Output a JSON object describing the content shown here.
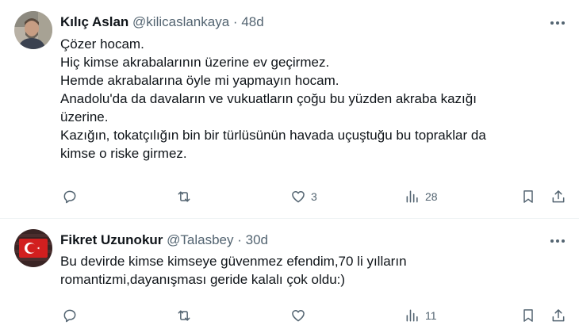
{
  "tweets": [
    {
      "author_name": "Kılıç Aslan",
      "handle": "@kilicaslankaya",
      "separator": "·",
      "time": "48d",
      "lines": [
        "Çözer hocam.",
        "Hiç kimse akrabalarının üzerine ev geçirmez.",
        "Hemde akrabalarına öyle mi yapmayın hocam.",
        "Anadolu'da da davaların ve vukuatların çoğu bu yüzden akraba kazığı",
        "üzerine.",
        "Kazığın, tokatçılığın bin bir türlüsünün havada uçuştuğu bu topraklar da",
        "kimse o riske girmez."
      ],
      "actions": {
        "replies": "",
        "reposts": "",
        "likes": "3",
        "views": "28"
      }
    },
    {
      "author_name": "Fikret Uzunokur",
      "handle": "@Talasbey",
      "separator": "·",
      "time": "30d",
      "lines": [
        "Bu devirde kimse kimseye güvenmez efendim,70 li yılların",
        "romantizmi,dayanışması geride kalalı çok oldu:)"
      ],
      "actions": {
        "replies": "",
        "reposts": "",
        "likes": "",
        "views": "11"
      }
    }
  ],
  "colors": {
    "text_primary": "#0f1419",
    "text_secondary": "#536471",
    "divider": "#eff3f4"
  },
  "icons": [
    "more-icon",
    "reply-icon",
    "retweet-icon",
    "like-icon",
    "views-icon",
    "bookmark-icon",
    "share-icon"
  ]
}
